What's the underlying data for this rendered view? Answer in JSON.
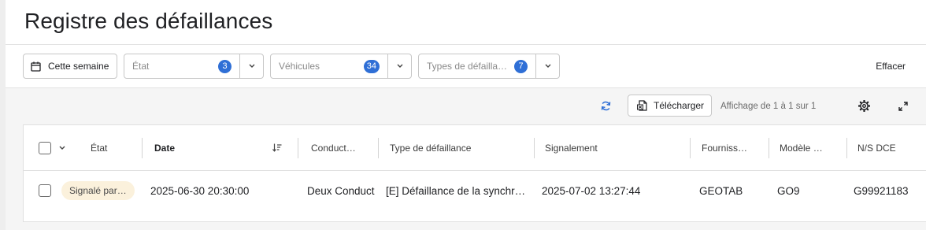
{
  "page": {
    "title": "Registre des défaillances"
  },
  "filters": {
    "date_button": "Cette semaine",
    "state": {
      "placeholder": "État",
      "count": "3"
    },
    "vehicles": {
      "placeholder": "Véhicules",
      "count": "34"
    },
    "fault_types": {
      "placeholder": "Types de défailla…",
      "count": "7"
    },
    "clear_label": "Effacer"
  },
  "toolbar": {
    "download_label": "Télécharger",
    "paging_text": "Affichage de 1 à 1 sur 1"
  },
  "table": {
    "columns": [
      "État",
      "Date",
      "Conduct…",
      "Type de défaillance",
      "Signalement",
      "Fourniss…",
      "Modèle …",
      "N/S DCE"
    ],
    "rows": [
      {
        "status": "Signalé par…",
        "date": "2025-06-30 20:30:00",
        "driver": "Deux Conduct",
        "fault_type": "[E] Défaillance de la synchr…",
        "reported": "2025-07-02 13:27:44",
        "supplier": "GEOTAB",
        "model": "GO9",
        "serial": "G99921183"
      }
    ]
  },
  "colors": {
    "accent": "#2f6fd6",
    "status_chip_bg": "#fbf1dc",
    "toolbar_bg": "#f5f5f5"
  }
}
